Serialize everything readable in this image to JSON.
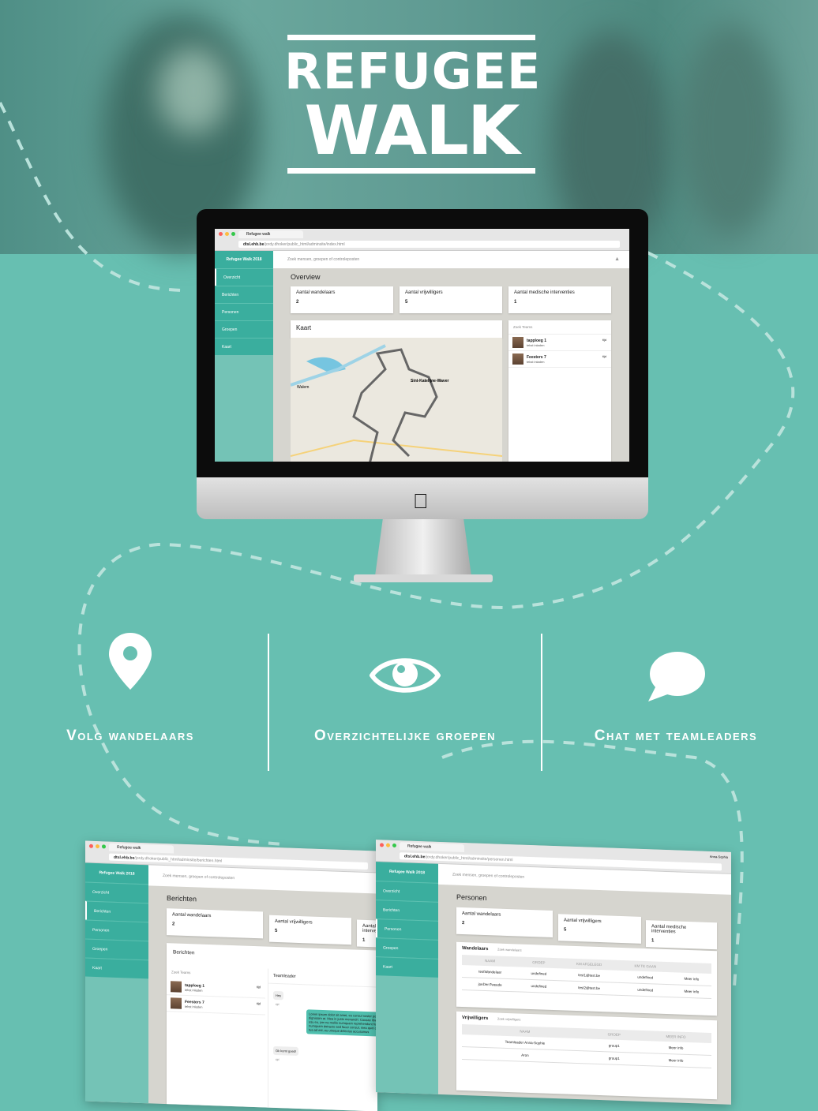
{
  "logo": {
    "line1": "REFUGEE",
    "line2": "WALK"
  },
  "colors": {
    "teal_bg": "#67bfb1",
    "sidebar": "#3aae9e",
    "content_bg": "#d6d5cf"
  },
  "browser": {
    "tab_title": "Refugee walk",
    "url_host": "dtsl.ehb.be",
    "url_path_index": "/jordy.dhoker/public_html/adminsite/index.html",
    "url_path_berichten": "/jordy.dhoker/public_html/adminsite/berichten.html",
    "url_path_personen": "/jordy.dhoker/public_html/adminsite/personen.html",
    "user": "Anna-Sophia"
  },
  "app": {
    "brand": "Refugee Walk 2018",
    "search_placeholder": "Zoek mensen, groepen of controleposten",
    "nav": [
      "Overzicht",
      "Berichten",
      "Personen",
      "Groepen",
      "Kaart"
    ],
    "stats": [
      {
        "label": "Aantal wandelaars",
        "value": "2"
      },
      {
        "label": "Aantal vrijwilligers",
        "value": "5"
      },
      {
        "label": "Aantal medische interventies",
        "value": "1"
      }
    ],
    "teams_placeholder": "Zoek Teams",
    "teams": [
      {
        "name": "tapploeg 1",
        "sub": "tekst inladen",
        "time": "tijd"
      },
      {
        "name": "Feesters 7",
        "sub": "tekst inladen",
        "time": "tijd"
      }
    ]
  },
  "overview": {
    "title": "Overview",
    "map_title": "Kaart",
    "map_labels": [
      "Sint-Katelijne-Waver",
      "Walem"
    ]
  },
  "berichten": {
    "title": "Berichten",
    "panel_title": "Berichten",
    "chat_title": "Teamleader",
    "messages": [
      {
        "text": "Hey",
        "time": "tijd"
      },
      {
        "text": "Lorem ipsum dolor sit amet, eu consul noster possim dignissim at. Mea in justo menandri. Causae liberavisse usu eu, per ne mollis numquam reprehendunt has. Sonet numquam detracto sed facer consul, mea quot case in. Eu tua ad est, eu utroque delectus accusamus"
      },
      {
        "text": "Ok komt goed!",
        "time": "tijd"
      }
    ]
  },
  "personen": {
    "title": "Personen",
    "walkers_title": "Wandelaars",
    "walkers_search": "Zoek wandelaars",
    "walkers_cols": [
      "NAAM",
      "GROEP",
      "KM AFGELEGD",
      "KM TE GAAN",
      ""
    ],
    "walkers_rows": [
      [
        "testWandelaar",
        "undefined",
        "test1@test.be",
        "undefined",
        "Meer info"
      ],
      [
        "joeDenTweede",
        "undefined",
        "test2@test.be",
        "undefined",
        "Meer info"
      ]
    ],
    "vol_title": "Vrijwilligers",
    "vol_search": "Zoek vrijwilligers",
    "vol_cols": [
      "NAAM",
      "GROEP",
      "MEER INFO"
    ],
    "vol_rows": [
      [
        "Teamleader Anna-Sophie",
        "group1",
        "Meer info"
      ],
      [
        "Aron",
        "group1",
        "Meer info"
      ]
    ]
  },
  "features": [
    {
      "icon": "map-pin-icon",
      "label": "Volg wandelaars"
    },
    {
      "icon": "eye-icon",
      "label": "Overzichtelijke groepen"
    },
    {
      "icon": "chat-bubble-icon",
      "label": "Chat met teamleaders"
    }
  ]
}
